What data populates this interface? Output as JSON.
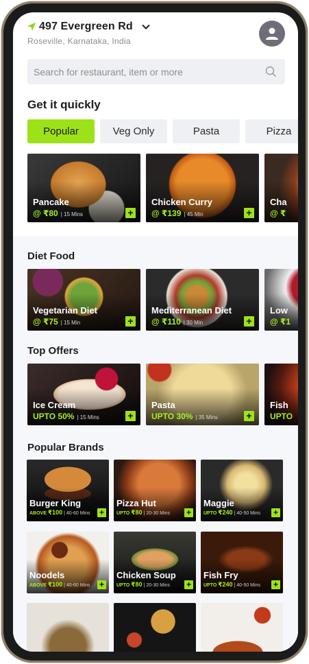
{
  "header": {
    "location_title": "497 Evergreen Rd",
    "location_subtitle": "Roseville, Karnataka, India"
  },
  "search": {
    "placeholder": "Search for restaurant, item or more"
  },
  "quick": {
    "title": "Get it quickly",
    "chips": [
      "Popular",
      "Veg Only",
      "Pasta",
      "Pizza"
    ],
    "cards": [
      {
        "name": "Pancake",
        "price": "@ ₹80",
        "time": "| 15 Mins"
      },
      {
        "name": "Chicken Curry",
        "price": "@ ₹139",
        "time": "| 45 Min"
      },
      {
        "name": "Cha",
        "price": "@ ₹",
        "time": ""
      }
    ]
  },
  "diet": {
    "title": "Diet Food",
    "cards": [
      {
        "name": "Vegetarian Diet",
        "price": "@ ₹75",
        "time": "| 15 Min"
      },
      {
        "name": "Mediterranean Diet",
        "price": "@ ₹110",
        "time": "| 30 Min"
      },
      {
        "name": "Low",
        "price": "@ ₹1",
        "time": ""
      }
    ]
  },
  "offers": {
    "title": "Top Offers",
    "cards": [
      {
        "name": "Ice Cream",
        "price": "UPTO 50%",
        "time": "| 15 Mins"
      },
      {
        "name": "Pasta",
        "price": "UPTO 30%",
        "time": "| 35 Mins"
      },
      {
        "name": "Fish",
        "price": "UPTO",
        "time": ""
      }
    ]
  },
  "brands": {
    "title": "Popular Brands",
    "items": [
      {
        "name": "Burger King",
        "prefix": "ABOVE",
        "amount": "₹100",
        "time": "| 40-60 Mins"
      },
      {
        "name": "Pizza Hut",
        "prefix": "UPTO",
        "amount": "₹80",
        "time": "| 20-30 Mins"
      },
      {
        "name": "Maggie",
        "prefix": "UPTO",
        "amount": "₹240",
        "time": "| 40-50 Mins"
      },
      {
        "name": "Noodels",
        "prefix": "ABOVE",
        "amount": "₹100",
        "time": "| 40-60 Mins"
      },
      {
        "name": "Chicken Soup",
        "prefix": "UPTO",
        "amount": "₹80",
        "time": "| 20-30 Mins"
      },
      {
        "name": "Fish Fry",
        "prefix": "UPTO",
        "amount": "₹240",
        "time": "| 40-50 Mins"
      }
    ]
  },
  "icons": {
    "location": "navigation-arrow-icon",
    "chevron": "chevron-down-icon",
    "avatar": "user-avatar-icon",
    "search": "search-icon",
    "add": "plus-icon"
  },
  "colors": {
    "accent": "#9de218",
    "accent_text": "#a6f01e",
    "chip_bg": "#eef0f3",
    "avatar_bg": "#6e6e78"
  }
}
